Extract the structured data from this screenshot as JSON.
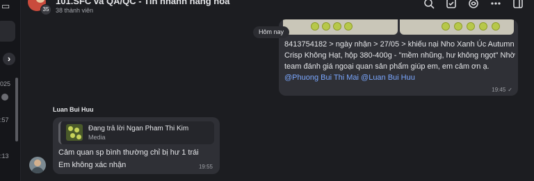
{
  "header": {
    "title": "101.SFC và QA/QC - Tin nhanh hàng hóa",
    "member_count_badge": "35",
    "subtitle": "38 thành viên",
    "actions": [
      {
        "name": "search-icon"
      },
      {
        "name": "tasks-icon"
      },
      {
        "name": "threads-icon"
      },
      {
        "name": "more-icon"
      },
      {
        "name": "sidebar-toggle-icon"
      }
    ]
  },
  "rail": {
    "snippets": [
      "025",
      ":57",
      ":13"
    ]
  },
  "day_separator": "Hôm nay",
  "outgoing_message": {
    "text_main": "8413754182 > ngày nhận > 27/05 > khiếu nại Nho Xanh Úc Autumn Crisp Không Hạt, hộp 380-400g  - \"mềm nhũng, hư không ngọt\"  Nhờ team đánh giá ngoại quan sản phẩm giúp em, em cảm ơn ạ. ",
    "mention_1": "@Phuong Bui Thi Mai",
    "mention_2": "@Luan Bui Huu",
    "time": "19:45"
  },
  "incoming_message": {
    "sender": "Luan Bui Huu",
    "reply_title": "Đang trả lời Ngan Pham Thi Kim",
    "reply_type": "Media",
    "line1": "Cảm quan sp bình thường chỉ bị hư 1 trái",
    "line2": "Em không xác nhận",
    "time": "19:55"
  }
}
